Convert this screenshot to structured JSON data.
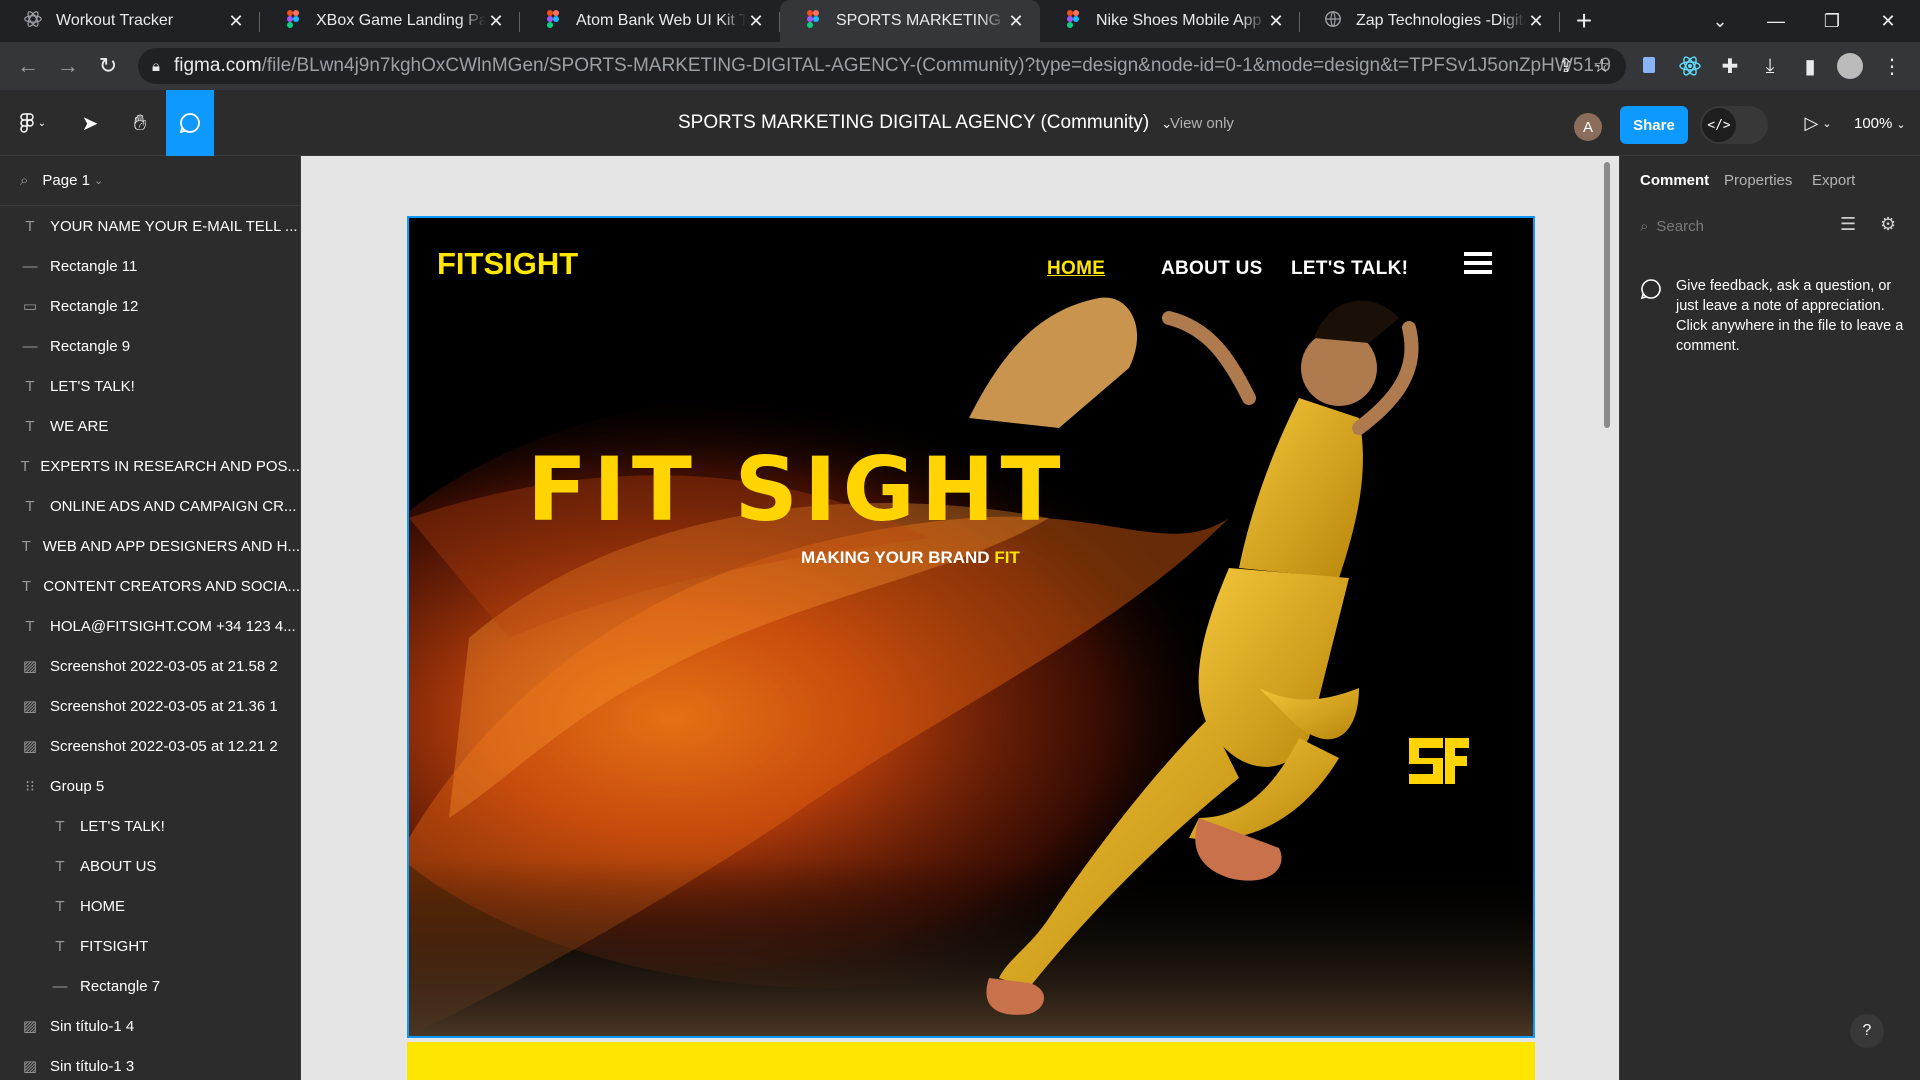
{
  "browser": {
    "tabs": [
      {
        "title": "Workout Tracker",
        "favicon": "react-icon"
      },
      {
        "title": "XBox Game Landing Page (Community)",
        "favicon": "figma-icon"
      },
      {
        "title": "Atom Bank Web UI Kit Template",
        "favicon": "figma-icon"
      },
      {
        "title": "SPORTS MARKETING DIGITAL AGENCY",
        "favicon": "figma-icon",
        "active": true
      },
      {
        "title": "Nike Shoes Mobile App UI Design",
        "favicon": "figma-icon"
      },
      {
        "title": "Zap Technologies -Digital Agency",
        "favicon": "globe-icon"
      }
    ],
    "url_host": "figma.com",
    "url_path": "/file/BLwn4j9n7kghOxCWlnMGen/SPORTS-MARKETING-DIGITAL-AGENCY-(Community)?type=design&node-id=0-1&mode=design&t=TPFSv1J5onZpHW51-0"
  },
  "figma": {
    "file_title": "SPORTS MARKETING DIGITAL AGENCY (Community)",
    "view_mode": "View only",
    "avatar_initial": "A",
    "share_label": "Share",
    "zoom": "100%",
    "page_name": "Page 1",
    "layers": [
      {
        "name": "YOUR NAME YOUR E-MAIL TELL ...",
        "icon": "text-icon"
      },
      {
        "name": "Rectangle 11",
        "icon": "line-icon"
      },
      {
        "name": "Rectangle 12",
        "icon": "rect-icon"
      },
      {
        "name": "Rectangle 9",
        "icon": "line-icon"
      },
      {
        "name": "LET'S TALK!",
        "icon": "text-icon"
      },
      {
        "name": "WE ARE",
        "icon": "text-icon"
      },
      {
        "name": "EXPERTS IN RESEARCH AND POS...",
        "icon": "text-icon"
      },
      {
        "name": "ONLINE ADS AND CAMPAIGN CR...",
        "icon": "text-icon"
      },
      {
        "name": "WEB AND APP DESIGNERS AND H...",
        "icon": "text-icon"
      },
      {
        "name": "CONTENT CREATORS AND SOCIA...",
        "icon": "text-icon"
      },
      {
        "name": "HOLA@FITSIGHT.COM +34 123 4...",
        "icon": "text-icon"
      },
      {
        "name": "Screenshot 2022-03-05 at 21.58 2",
        "icon": "image-icon"
      },
      {
        "name": "Screenshot 2022-03-05 at 21.36 1",
        "icon": "image-icon"
      },
      {
        "name": "Screenshot 2022-03-05 at 12.21 2",
        "icon": "image-icon"
      },
      {
        "name": "Group 5",
        "icon": "group-icon"
      },
      {
        "name": "LET'S TALK!",
        "icon": "text-icon",
        "child": true
      },
      {
        "name": "ABOUT US",
        "icon": "text-icon",
        "child": true
      },
      {
        "name": "HOME",
        "icon": "text-icon",
        "child": true
      },
      {
        "name": "FITSIGHT",
        "icon": "text-icon",
        "child": true
      },
      {
        "name": "Rectangle 7",
        "icon": "line-icon",
        "child": true
      },
      {
        "name": "Sin título-1 4",
        "icon": "image-icon"
      },
      {
        "name": "Sin título-1 3",
        "icon": "image-icon"
      }
    ],
    "right_tabs": [
      "Comment",
      "Properties",
      "Export"
    ],
    "comment_search_placeholder": "Search",
    "comment_hint": "Give feedback, ask a question, or just leave a note of appreciation. Click anywhere in the file to leave a comment.",
    "help_label": "?"
  },
  "design": {
    "logo": "FITSIGHT",
    "nav": [
      "HOME",
      "ABOUT US",
      "LET'S TALK!"
    ],
    "hero_title_left": "FIT",
    "hero_title_right": "SIGHT",
    "tagline_main": "MAKING YOUR BRAND",
    "tagline_accent": "FIT",
    "colors": {
      "accent": "#FFE600",
      "dark": "#000000",
      "selection": "#0D99FF",
      "share": "#0D99FF"
    }
  }
}
